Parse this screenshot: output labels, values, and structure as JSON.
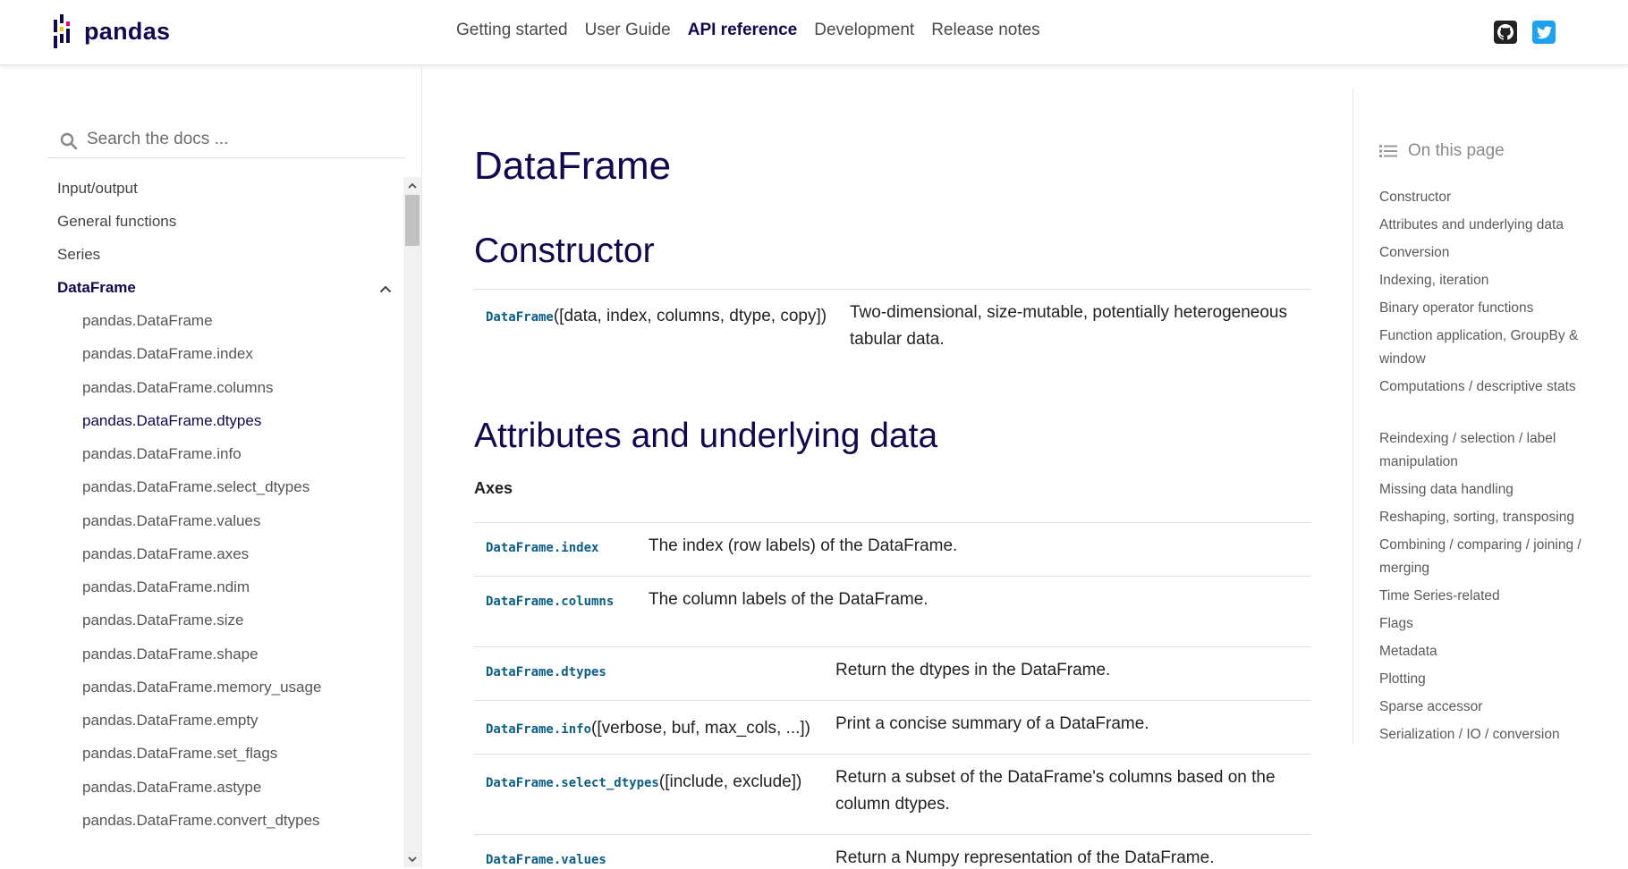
{
  "brand": {
    "name": "pandas",
    "colors": {
      "navy": "#130754",
      "yellow": "#ffca00",
      "pink": "#e70488",
      "code": "#0b5e8a"
    }
  },
  "nav": {
    "links": [
      "Getting started",
      "User Guide",
      "API reference",
      "Development",
      "Release notes"
    ],
    "active": "API reference"
  },
  "social": {
    "github": "github-icon",
    "twitter": "twitter-icon"
  },
  "sidebar": {
    "search_placeholder": "Search the docs ...",
    "sections": [
      "Input/output",
      "General functions",
      "Series",
      "DataFrame"
    ],
    "active_section": "DataFrame",
    "subitems": [
      "pandas.DataFrame",
      "pandas.DataFrame.index",
      "pandas.DataFrame.columns",
      "pandas.DataFrame.dtypes",
      "pandas.DataFrame.info",
      "pandas.DataFrame.select_dtypes",
      "pandas.DataFrame.values",
      "pandas.DataFrame.axes",
      "pandas.DataFrame.ndim",
      "pandas.DataFrame.size",
      "pandas.DataFrame.shape",
      "pandas.DataFrame.memory_usage",
      "pandas.DataFrame.empty",
      "pandas.DataFrame.set_flags",
      "pandas.DataFrame.astype",
      "pandas.DataFrame.convert_dtypes"
    ],
    "current_subitem": "pandas.DataFrame.dtypes"
  },
  "main": {
    "title": "DataFrame",
    "constructor": {
      "heading": "Constructor",
      "rows": [
        {
          "name": "DataFrame",
          "args": "([data, index, columns, dtype, copy])",
          "desc": "Two-dimensional, size-mutable, potentially heterogeneous tabular data."
        }
      ]
    },
    "attributes": {
      "heading": "Attributes and underlying data",
      "subheading": "Axes",
      "axes_rows": [
        {
          "name": "DataFrame.index",
          "args": "",
          "desc": "The index (row labels) of the DataFrame."
        },
        {
          "name": "DataFrame.columns",
          "args": "",
          "desc": "The column labels of the DataFrame."
        }
      ],
      "rows": [
        {
          "name": "DataFrame.dtypes",
          "args": "",
          "desc": "Return the dtypes in the DataFrame."
        },
        {
          "name": "DataFrame.info",
          "args": "([verbose, buf, max_cols, ...])",
          "desc": "Print a concise summary of a DataFrame."
        },
        {
          "name": "DataFrame.select_dtypes",
          "args": "([include, exclude])",
          "desc": "Return a subset of the DataFrame's columns based on the column dtypes."
        },
        {
          "name": "DataFrame.values",
          "args": "",
          "desc": "Return a Numpy representation of the DataFrame."
        }
      ]
    }
  },
  "toc": {
    "title": "On this page",
    "items": [
      "Constructor",
      "Attributes and underlying data",
      "Conversion",
      "Indexing, iteration",
      "Binary operator functions",
      "Function application, GroupBy & window",
      "Computations / descriptive stats",
      "Reindexing / selection / label manipulation",
      "Missing data handling",
      "Reshaping, sorting, transposing",
      "Combining / comparing / joining / merging",
      "Time Series-related",
      "Flags",
      "Metadata",
      "Plotting",
      "Sparse accessor",
      "Serialization / IO / conversion"
    ]
  }
}
